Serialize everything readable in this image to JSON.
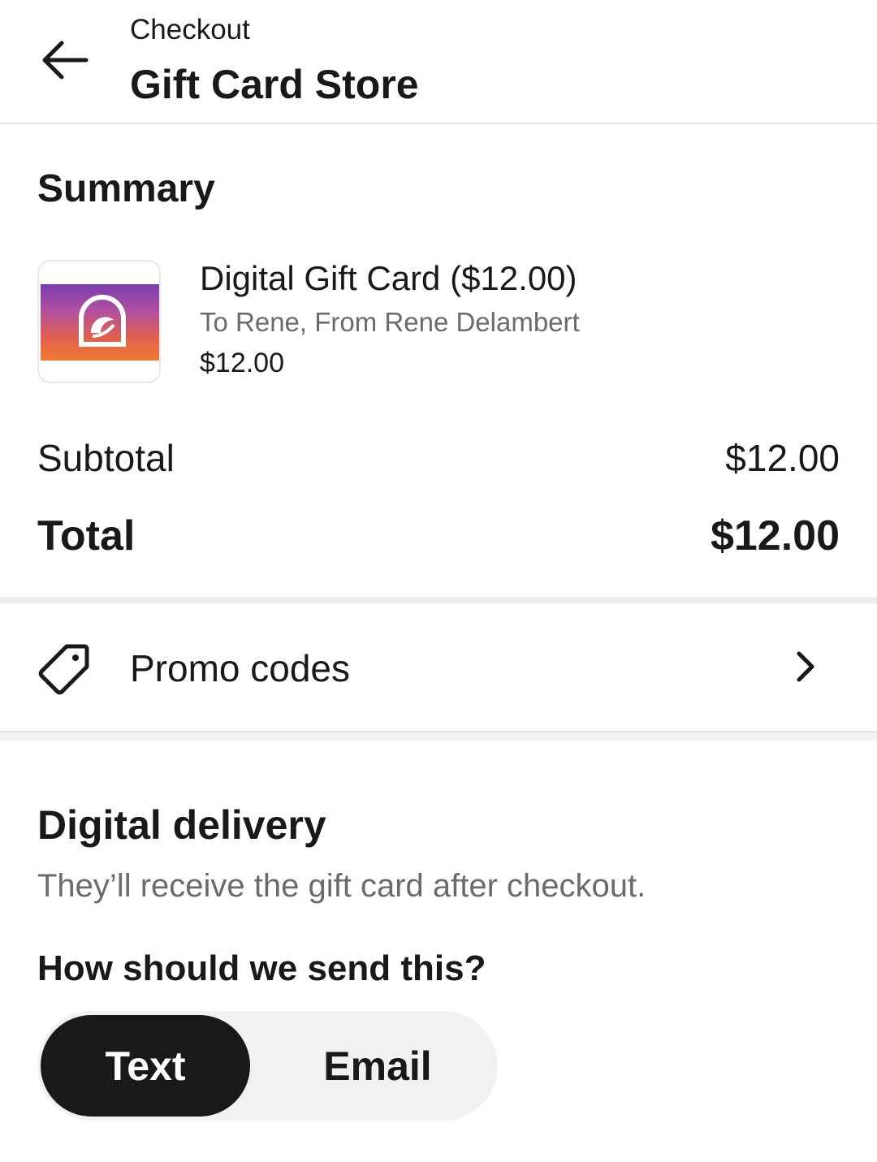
{
  "header": {
    "subtitle": "Checkout",
    "title": "Gift Card Store",
    "back_icon": "arrow-left-icon"
  },
  "summary": {
    "title": "Summary",
    "item": {
      "name": "Digital Gift Card ($12.00)",
      "description": "To Rene, From Rene Delambert",
      "price": "$12.00",
      "thumbnail_icon": "taco-bell-gift-card"
    },
    "subtotal_label": "Subtotal",
    "subtotal_value": "$12.00",
    "total_label": "Total",
    "total_value": "$12.00"
  },
  "promo": {
    "label": "Promo codes",
    "icon": "tag-icon",
    "chevron": "chevron-right-icon"
  },
  "delivery": {
    "title": "Digital delivery",
    "description": "They’ll receive the gift card after checkout.",
    "question": "How should we send this?",
    "options": [
      {
        "label": "Text",
        "selected": true
      },
      {
        "label": "Email",
        "selected": false
      }
    ]
  },
  "colors": {
    "text_primary": "#191919",
    "text_secondary": "#6b6b6b",
    "selected_bg": "#191919",
    "segment_bg": "#f1f1f1"
  }
}
